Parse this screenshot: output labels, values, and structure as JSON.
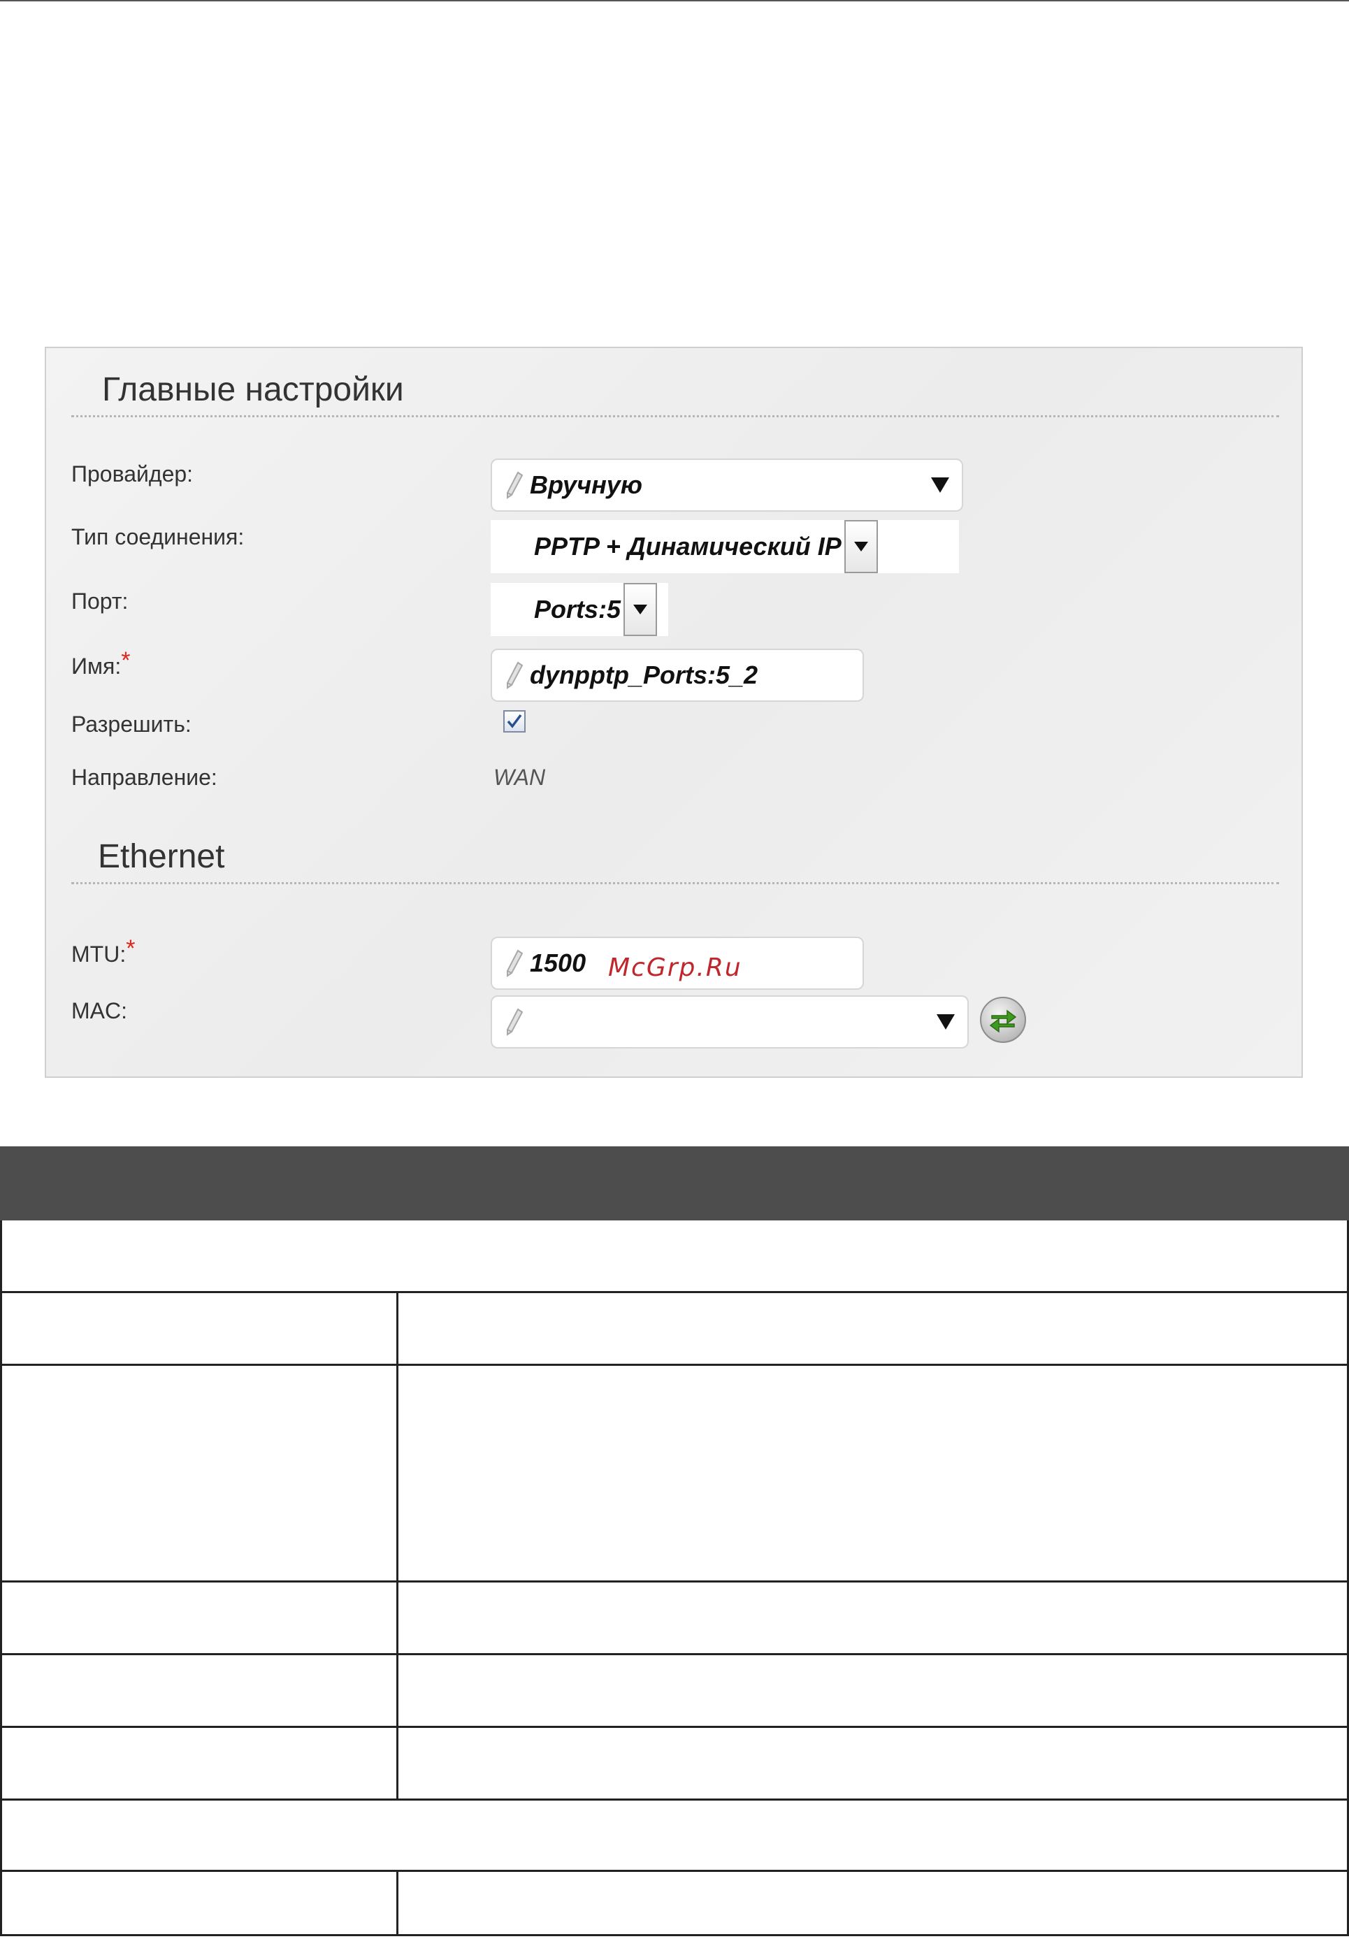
{
  "main_settings": {
    "title": "Главные настройки",
    "fields": {
      "provider": {
        "label": "Провайдер:",
        "value": "Вручную"
      },
      "connection_type": {
        "label": "Тип соединения:",
        "value": "PPTP + Динамический IP"
      },
      "port": {
        "label": "Порт:",
        "value": "Ports:5"
      },
      "name": {
        "label": "Имя:",
        "required_mark": "*",
        "value": "dynpptp_Ports:5_2"
      },
      "enable": {
        "label": "Разрешить:",
        "checked": true
      },
      "direction": {
        "label": "Направление:",
        "value": "WAN"
      }
    }
  },
  "ethernet": {
    "title": "Ethernet",
    "fields": {
      "mtu": {
        "label": "MTU:",
        "required_mark": "*",
        "value": "1500"
      },
      "mac": {
        "label": "MAC:",
        "value": ""
      }
    }
  },
  "watermark": "McGrp.Ru",
  "icons": {
    "pencil": "pencil-icon",
    "dropdown": "chevron-down-icon",
    "checkbox": "checkmark-icon",
    "refresh": "refresh-arrows-icon"
  },
  "colors": {
    "required": "#e0231b",
    "table_header": "#4d4d4d",
    "refresh_arrows": "#3f9b1f"
  }
}
